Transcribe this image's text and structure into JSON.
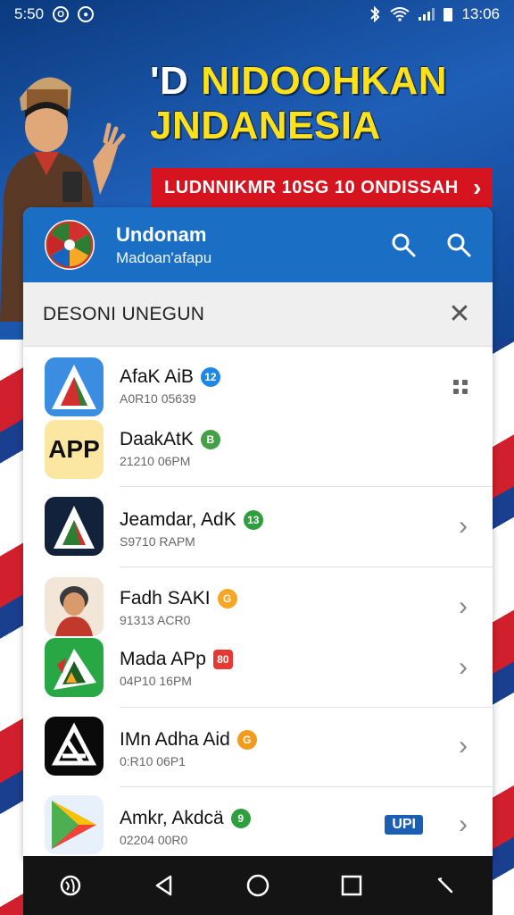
{
  "status_bar": {
    "time_left": "5:50",
    "time_right": "13:06"
  },
  "banner": {
    "prefix": "'D",
    "title_line1": "NIDOOHKAN",
    "title_line2": "JNDANESIA",
    "subtitle": "LUDNNIKMR 10SG 10 ONDISSAH"
  },
  "header": {
    "title": "Undonam",
    "subtitle": "Madoan'afapu"
  },
  "section": {
    "title": "DESONI UNEGUN"
  },
  "apps": [
    {
      "name": "AfaK AiB",
      "meta": "A0R10 05639",
      "badge_color": "#1e88e5",
      "badge_glyph": "12"
    },
    {
      "name": "DaakAtK",
      "meta": "21210 06PM",
      "badge_color": "#43a047",
      "badge_glyph": "B",
      "icon_text": "APP"
    },
    {
      "name": "Jeamdar, AdK",
      "meta": "S9710 RAPM",
      "badge_color": "#2e9e3e",
      "badge_glyph": "13"
    },
    {
      "name": "Fadh SAKI",
      "meta": "91313 ACR0",
      "badge_color": "#f5a623",
      "badge_glyph": "G"
    },
    {
      "name": "Mada APp",
      "meta": "04P10 16PM",
      "badge_color": "#e53935",
      "badge_glyph": "80"
    },
    {
      "name": "IMn Adha Aid",
      "meta": "0:R10 06P1",
      "badge_color": "#f29b1c",
      "badge_glyph": "G"
    },
    {
      "name": "Amkr, Akdcä",
      "meta": "02204 00R0",
      "badge_color": "#2e9e3e",
      "badge_glyph": "9",
      "tag": "UPI"
    }
  ],
  "colors": {
    "header_blue": "#1a6fc4",
    "banner_red": "#d6141f",
    "title_yellow": "#ffe11a"
  },
  "icons": [
    "search-icon",
    "close-icon",
    "chevron-right-icon",
    "back-icon",
    "home-icon",
    "recents-icon"
  ]
}
